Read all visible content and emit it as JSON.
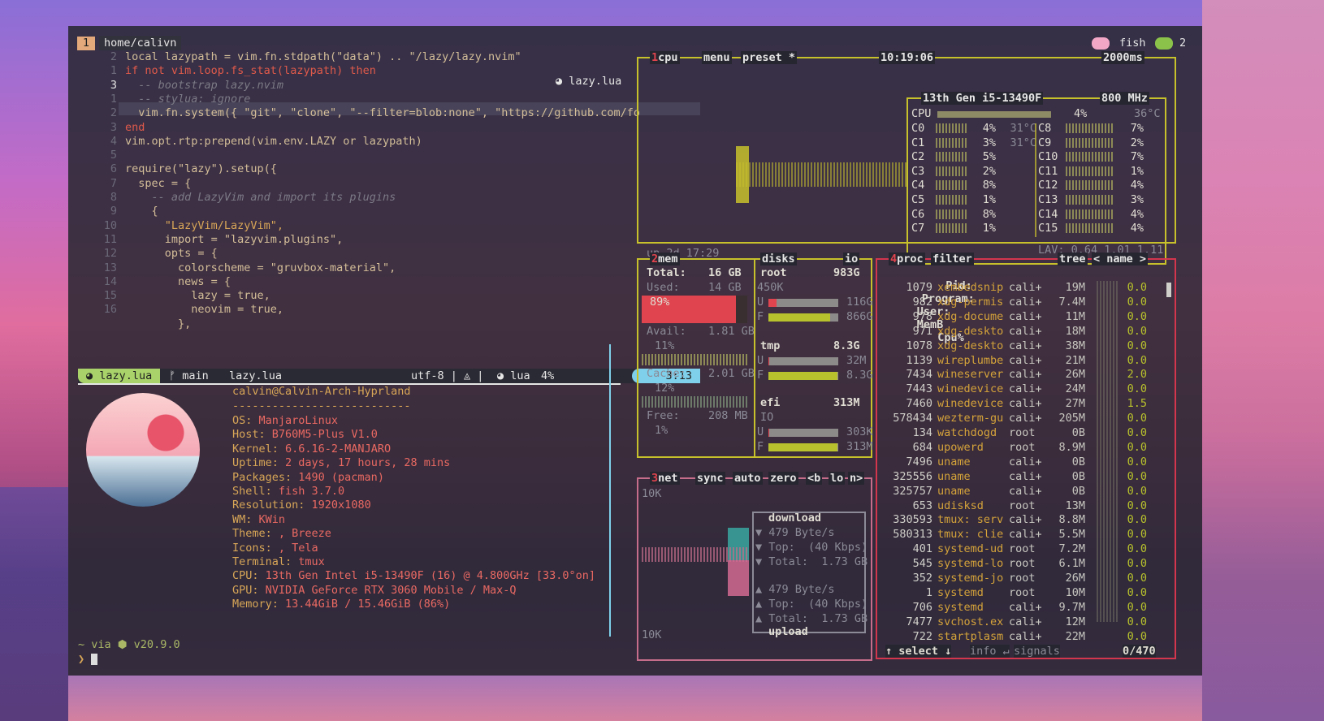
{
  "tmux": {
    "tab_number": "1",
    "tab_path": "home/calivn",
    "right_shell": "fish",
    "right_window": "2"
  },
  "editor": {
    "file_tag": "lazy.lua",
    "line_numbers": [
      "2",
      "1",
      "3",
      "1",
      "2",
      "3",
      "4",
      "5",
      "6",
      "7",
      "8",
      "9",
      "10",
      "11",
      "12",
      "13",
      "14",
      "15",
      "16",
      ""
    ],
    "lines": [
      "local lazypath = vim.fn.stdpath(\"data\") .. \"/lazy/lazy.nvim\"",
      "if not vim.loop.fs_stat(lazypath) then",
      "  -- bootstrap lazy.nvim",
      "  -- stylua: ignore",
      "  vim.fn.system({ \"git\", \"clone\", \"--filter=blob:none\", \"https://github.com/fo",
      "end",
      "vim.opt.rtp:prepend(vim.env.LAZY or lazypath)",
      "",
      "require(\"lazy\").setup({",
      "  spec = {",
      "    -- add LazyVim and import its plugins",
      "    {",
      "      \"LazyVim/LazyVim\",",
      "      import = \"lazyvim.plugins\",",
      "      opts = {",
      "        colorscheme = \"gruvbox-material\",",
      "        news = {",
      "          lazy = true,",
      "          neovim = true,",
      "        },"
    ],
    "status": {
      "mode_file": "lazy.lua",
      "branch": "main",
      "file": "lazy.lua",
      "encoding": "utf-8 | ◬ |",
      "filetype": "lua",
      "percent": "4%",
      "position": "3:13"
    }
  },
  "neofetch": {
    "user_host": "calvin@Calvin-Arch-Hyprland",
    "separator": "---------------------------",
    "info": [
      {
        "k": "OS: ",
        "v": "ManjaroLinux"
      },
      {
        "k": "Host: ",
        "v": "B760M5-Plus V1.0"
      },
      {
        "k": "Kernel: ",
        "v": "6.6.16-2-MANJARO"
      },
      {
        "k": "Uptime: ",
        "v": "2 days, 17 hours, 28 mins"
      },
      {
        "k": "Packages: ",
        "v": "1490 (pacman)"
      },
      {
        "k": "Shell: ",
        "v": "fish 3.7.0"
      },
      {
        "k": "Resolution: ",
        "v": "1920x1080"
      },
      {
        "k": "WM: ",
        "v": "KWin"
      },
      {
        "k": "Theme: ",
        "v": ", Breeze"
      },
      {
        "k": "Icons: ",
        "v": ", Tela"
      },
      {
        "k": "Terminal: ",
        "v": "tmux"
      },
      {
        "k": "CPU: ",
        "v": "13th Gen Intel i5-13490F (16) @ 4.800GHz [33.0°on]"
      },
      {
        "k": "GPU: ",
        "v": "NVIDIA GeForce RTX 3060 Mobile / Max-Q"
      },
      {
        "k": "Memory: ",
        "v": "13.44GiB / 15.46GiB (86%)"
      }
    ],
    "prompt_line1": "~ via ⬢ v20.9.0",
    "prompt_line2": "❯"
  },
  "btop": {
    "cpu": {
      "title_num": "1",
      "title": "cpu",
      "menu": "menu",
      "preset": "preset *",
      "clock": "10:19:06",
      "interval": "2000ms",
      "model": "13th Gen i5-13490F",
      "freq": "800 MHz",
      "total_label": "CPU",
      "total_pct": "4%",
      "total_temp": "36°C",
      "uptime": "up 2d 17:29",
      "lav": "LAV: 0.64 1.01 1.11",
      "cores_left": [
        {
          "n": "C0",
          "p": "4%",
          "t": "31°C"
        },
        {
          "n": "C1",
          "p": "3%",
          "t": "31°C"
        },
        {
          "n": "C2",
          "p": "5%",
          "t": ""
        },
        {
          "n": "C3",
          "p": "2%",
          "t": ""
        },
        {
          "n": "C4",
          "p": "8%",
          "t": ""
        },
        {
          "n": "C5",
          "p": "1%",
          "t": ""
        },
        {
          "n": "C6",
          "p": "8%",
          "t": ""
        },
        {
          "n": "C7",
          "p": "1%",
          "t": ""
        }
      ],
      "cores_right": [
        {
          "n": "C8",
          "p": "7%"
        },
        {
          "n": "C9",
          "p": "2%"
        },
        {
          "n": "C10",
          "p": "7%"
        },
        {
          "n": "C11",
          "p": "1%"
        },
        {
          "n": "C12",
          "p": "4%"
        },
        {
          "n": "C13",
          "p": "3%"
        },
        {
          "n": "C14",
          "p": "4%"
        },
        {
          "n": "C15",
          "p": "4%"
        }
      ]
    },
    "mem": {
      "title_num": "2",
      "title": "mem",
      "total_label": "Total:",
      "total": "16 GB",
      "used_label": "Used:",
      "used": "14 GB",
      "used_pct": "89%",
      "used_fraction": 0.89,
      "avail_label": "Avail:",
      "avail": "1.81 GB",
      "avail_pct": "11%",
      "cache_label": "Cache:",
      "cache": "2.01 GB",
      "cache_pct": "12%",
      "free_label": "Free:",
      "free": "208 MB",
      "free_pct": "1%"
    },
    "disks": {
      "title": "disks",
      "io": "io",
      "root": {
        "name": "root",
        "size": "983G",
        "io": "450K",
        "u": "116G",
        "f": "866G",
        "u_frac": 0.12,
        "f_frac": 0.88
      },
      "tmp": {
        "name": "tmp",
        "size": "8.3G",
        "u": "32M",
        "f": "8.3G",
        "u_frac": 0.01,
        "f_frac": 0.99
      },
      "efi": {
        "name": "efi",
        "size": "313M",
        "io_label": "IO",
        "u": "303K",
        "f": "313M",
        "u_frac": 0.01,
        "f_frac": 0.99
      }
    },
    "net": {
      "title_num": "3",
      "title": "net",
      "sync": "sync",
      "auto": "auto",
      "zero": "zero",
      "prev": "<b",
      "iface": "lo",
      "next": "n>",
      "scale_top": "10K",
      "scale_bottom": "10K",
      "download_label": "download",
      "dl_rate": "479 Byte/s",
      "dl_top": "Top:  (40 Kbps)",
      "dl_total": "Total:  1.73 GB",
      "ul_rate": "479 Byte/s",
      "ul_top": "Top:  (40 Kbps)",
      "ul_total": "Total:  1.73 GB",
      "upload_label": "upload"
    },
    "proc": {
      "title_num": "4",
      "title": "proc",
      "filter": "filter",
      "tree": "tree",
      "sort": "< name >",
      "headers": {
        "pid": "Pid:",
        "program": "Program:",
        "user": "User:",
        "mem": "MemB",
        "cpu": "Cpu%"
      },
      "rows": [
        {
          "pid": "1079",
          "prog": "xembedsnip",
          "user": "cali+",
          "mem": "19M",
          "cpu": "0.0"
        },
        {
          "pid": "982",
          "prog": "xdg-permis",
          "user": "cali+",
          "mem": "7.4M",
          "cpu": "0.0"
        },
        {
          "pid": "978",
          "prog": "xdg-docume",
          "user": "cali+",
          "mem": "11M",
          "cpu": "0.0"
        },
        {
          "pid": "971",
          "prog": "xdg-deskto",
          "user": "cali+",
          "mem": "18M",
          "cpu": "0.0"
        },
        {
          "pid": "1078",
          "prog": "xdg-deskto",
          "user": "cali+",
          "mem": "38M",
          "cpu": "0.0"
        },
        {
          "pid": "1139",
          "prog": "wireplumbe",
          "user": "cali+",
          "mem": "21M",
          "cpu": "0.0"
        },
        {
          "pid": "7434",
          "prog": "wineserver",
          "user": "cali+",
          "mem": "26M",
          "cpu": "2.0"
        },
        {
          "pid": "7443",
          "prog": "winedevice",
          "user": "cali+",
          "mem": "24M",
          "cpu": "0.0"
        },
        {
          "pid": "7460",
          "prog": "winedevice",
          "user": "cali+",
          "mem": "27M",
          "cpu": "1.5"
        },
        {
          "pid": "578434",
          "prog": "wezterm-gu",
          "user": "cali+",
          "mem": "205M",
          "cpu": "0.0"
        },
        {
          "pid": "134",
          "prog": "watchdogd",
          "user": "root",
          "mem": "0B",
          "cpu": "0.0"
        },
        {
          "pid": "684",
          "prog": "upowerd",
          "user": "root",
          "mem": "8.9M",
          "cpu": "0.0"
        },
        {
          "pid": "7496",
          "prog": "uname",
          "user": "cali+",
          "mem": "0B",
          "cpu": "0.0"
        },
        {
          "pid": "325556",
          "prog": "uname",
          "user": "cali+",
          "mem": "0B",
          "cpu": "0.0"
        },
        {
          "pid": "325757",
          "prog": "uname",
          "user": "cali+",
          "mem": "0B",
          "cpu": "0.0"
        },
        {
          "pid": "653",
          "prog": "udisksd",
          "user": "root",
          "mem": "13M",
          "cpu": "0.0"
        },
        {
          "pid": "330593",
          "prog": "tmux: serv",
          "user": "cali+",
          "mem": "8.8M",
          "cpu": "0.0"
        },
        {
          "pid": "580313",
          "prog": "tmux: clie",
          "user": "cali+",
          "mem": "5.5M",
          "cpu": "0.0"
        },
        {
          "pid": "401",
          "prog": "systemd-ud",
          "user": "root",
          "mem": "7.2M",
          "cpu": "0.0"
        },
        {
          "pid": "545",
          "prog": "systemd-lo",
          "user": "root",
          "mem": "6.1M",
          "cpu": "0.0"
        },
        {
          "pid": "352",
          "prog": "systemd-jo",
          "user": "root",
          "mem": "26M",
          "cpu": "0.0"
        },
        {
          "pid": "1",
          "prog": "systemd",
          "user": "root",
          "mem": "10M",
          "cpu": "0.0"
        },
        {
          "pid": "706",
          "prog": "systemd",
          "user": "cali+",
          "mem": "9.7M",
          "cpu": "0.0"
        },
        {
          "pid": "7477",
          "prog": "svchost.ex",
          "user": "cali+",
          "mem": "12M",
          "cpu": "0.0"
        },
        {
          "pid": "722",
          "prog": "startplasm",
          "user": "cali+",
          "mem": "22M",
          "cpu": "0.0"
        }
      ],
      "select": "↑ select ↓",
      "info": "info ↵",
      "signals": "signals",
      "count": "0/470"
    }
  },
  "colors": {
    "accent_yellow": "#c7c12b",
    "accent_red": "#d4364e",
    "accent_pink": "#c56d8a",
    "neo_key": "#d8a657",
    "neo_val": "#ea6962"
  }
}
